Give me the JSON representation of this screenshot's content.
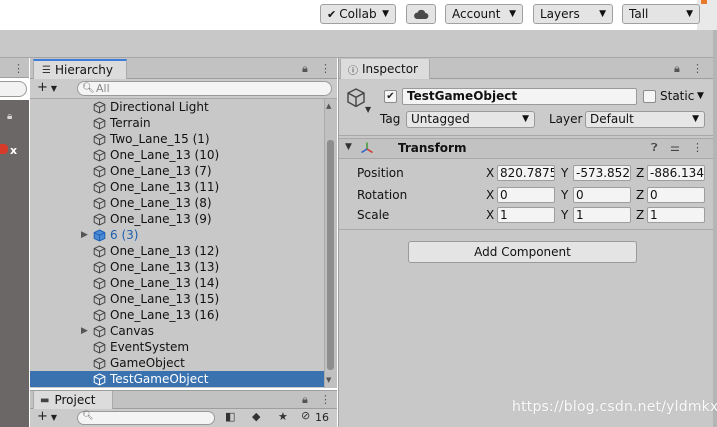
{
  "toolbar": {
    "collab_label": "Collab",
    "account_label": "Account",
    "layers_label": "Layers",
    "layout_label": "Tall"
  },
  "hierarchy": {
    "tab_label": "Hierarchy",
    "search_placeholder": "All",
    "items": [
      {
        "label": "Directional Light",
        "expandable": false,
        "prefab": false,
        "selected": false
      },
      {
        "label": "Terrain",
        "expandable": false,
        "prefab": false,
        "selected": false
      },
      {
        "label": "Two_Lane_15 (1)",
        "expandable": false,
        "prefab": false,
        "selected": false
      },
      {
        "label": "One_Lane_13 (10)",
        "expandable": false,
        "prefab": false,
        "selected": false
      },
      {
        "label": "One_Lane_13 (7)",
        "expandable": false,
        "prefab": false,
        "selected": false
      },
      {
        "label": "One_Lane_13 (11)",
        "expandable": false,
        "prefab": false,
        "selected": false
      },
      {
        "label": "One_Lane_13 (8)",
        "expandable": false,
        "prefab": false,
        "selected": false
      },
      {
        "label": "One_Lane_13 (9)",
        "expandable": false,
        "prefab": false,
        "selected": false
      },
      {
        "label": "6 (3)",
        "expandable": true,
        "prefab": true,
        "selected": false
      },
      {
        "label": "One_Lane_13 (12)",
        "expandable": false,
        "prefab": false,
        "selected": false
      },
      {
        "label": "One_Lane_13 (13)",
        "expandable": false,
        "prefab": false,
        "selected": false
      },
      {
        "label": "One_Lane_13 (14)",
        "expandable": false,
        "prefab": false,
        "selected": false
      },
      {
        "label": "One_Lane_13 (15)",
        "expandable": false,
        "prefab": false,
        "selected": false
      },
      {
        "label": "One_Lane_13 (16)",
        "expandable": false,
        "prefab": false,
        "selected": false
      },
      {
        "label": "Canvas",
        "expandable": true,
        "prefab": false,
        "selected": false
      },
      {
        "label": "EventSystem",
        "expandable": false,
        "prefab": false,
        "selected": false
      },
      {
        "label": "GameObject",
        "expandable": false,
        "prefab": false,
        "selected": false
      },
      {
        "label": "TestGameObject",
        "expandable": false,
        "prefab": false,
        "selected": true
      }
    ]
  },
  "project": {
    "tab_label": "Project",
    "hidden_count": "16"
  },
  "inspector": {
    "tab_label": "Inspector",
    "object_name": "TestGameObject",
    "active": true,
    "static_label": "Static",
    "tag_label": "Tag",
    "tag_value": "Untagged",
    "layer_label": "Layer",
    "layer_value": "Default",
    "transform": {
      "title": "Transform",
      "position_label": "Position",
      "rotation_label": "Rotation",
      "scale_label": "Scale",
      "axis_x": "X",
      "axis_y": "Y",
      "axis_z": "Z",
      "position": {
        "x": "820.7875",
        "y": "-573.852",
        "z": "-886.134"
      },
      "rotation": {
        "x": "0",
        "y": "0",
        "z": "0"
      },
      "scale": {
        "x": "1",
        "y": "1",
        "z": "1"
      }
    },
    "add_component_label": "Add Component"
  },
  "watermark": "https://blog.csdn.net/yldmkx",
  "colors": {
    "selection": "#3a72b0",
    "prefab_text": "#1f5fb0",
    "panel_bg": "#c8c8c8",
    "tab_accent": "#3d7fd8"
  }
}
